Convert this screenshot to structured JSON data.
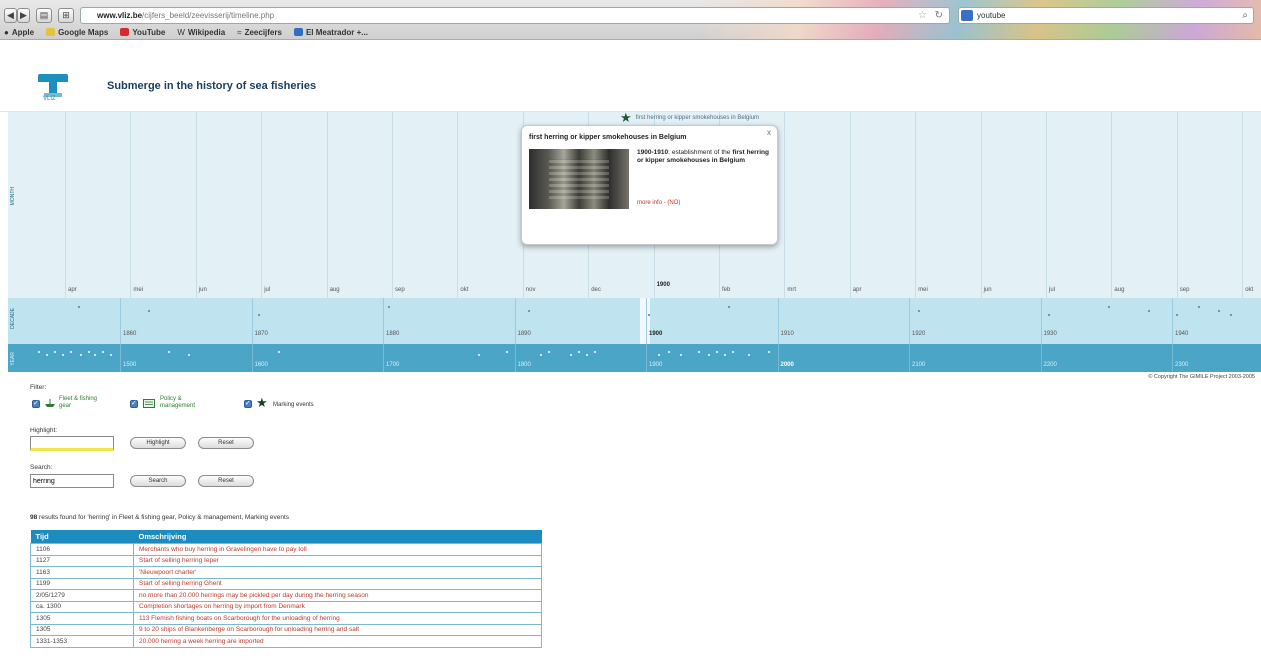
{
  "browser": {
    "url_host": "www.vliz.be",
    "url_path": "/cijfers_beeld/zeevisserij/timeline.php",
    "search_query": "youtube",
    "bookmarks": [
      "Apple",
      "Google Maps",
      "YouTube",
      "Wikipedia",
      "Zeecijfers",
      "El Meatrador +..."
    ]
  },
  "site": {
    "title": "Submerge in the history of sea fisheries",
    "logo_text": "VLIZ"
  },
  "timeline": {
    "band_labels": [
      "MONTH",
      "DECADE",
      "YEAR"
    ],
    "months": [
      "apr",
      "mei",
      "jun",
      "jul",
      "aug",
      "sep",
      "okt",
      "nov",
      "dec",
      "1900",
      "feb",
      "mrt",
      "apr",
      "mei",
      "jun",
      "jul",
      "aug",
      "sep",
      "okt"
    ],
    "decades": [
      "1860",
      "1870",
      "1880",
      "1890",
      "1900",
      "1910",
      "1920",
      "1930",
      "1940"
    ],
    "centuries": [
      "1500",
      "1600",
      "1700",
      "1800",
      "1900",
      "2000",
      "2100",
      "2200",
      "2300"
    ],
    "marker_label": "first herring or kipper smokehouses in Belgium",
    "popup": {
      "title": "first herring or kipper smokehouses in Belgium",
      "years": "1900-1910",
      "description": ": establishment of the",
      "name": "first herring or kipper smokehouses in Belgium",
      "more_link": "more info - (NO)",
      "close": "x"
    }
  },
  "copyright": "© Copyright The GIMILE Project 2003-2005",
  "filter": {
    "title": "Filter:",
    "options": [
      {
        "label_line1": "Fleet & fishing",
        "label_line2": "gear",
        "color": "#2e7d32"
      },
      {
        "label_line1": "Policy &",
        "label_line2": "management",
        "color": "#2e7d32"
      },
      {
        "label_line1": "Marking events",
        "label_line2": "",
        "color": "#1b3d1f"
      }
    ]
  },
  "highlight": {
    "label": "Highlight:",
    "value": "",
    "button": "Highlight",
    "reset": "Reset"
  },
  "search": {
    "label": "Search:",
    "value": "herring",
    "button": "Search",
    "reset": "Reset"
  },
  "results": {
    "count": "98",
    "summary": " results found for 'herring' in Fleet & fishing gear, Policy & management, Marking events",
    "columns": [
      "Tijd",
      "Omschrijving"
    ],
    "rows": [
      {
        "time": "1106",
        "desc": "Merchants who buy herring in Gravelingen have to pay toll"
      },
      {
        "time": "1127",
        "desc": "Start of selling herring Ieper"
      },
      {
        "time": "1163",
        "desc": "'Nieuwpoort charter'"
      },
      {
        "time": "1199",
        "desc": "Start of selling herring Ghent"
      },
      {
        "time": "2/05/1279",
        "desc": "no more than 20.000 herrings may be pickled per day during the herring season"
      },
      {
        "time": "ca. 1300",
        "desc": "Completion shortages on herring by import from Denmark"
      },
      {
        "time": "1305",
        "desc": "113 Flemish fishing boats on Scarborough for the unloading of herring"
      },
      {
        "time": "1305",
        "desc": "9 to 20 ships of Blankenberge on Scarborough for unloading herring and salt"
      },
      {
        "time": "1331-1353",
        "desc": "20.000 herring a week herring are imported"
      }
    ]
  }
}
